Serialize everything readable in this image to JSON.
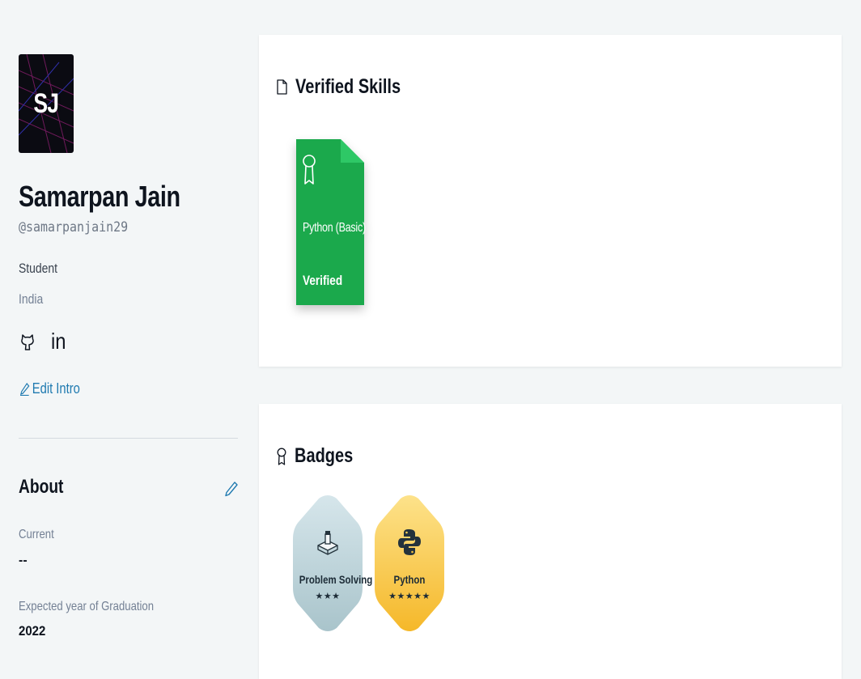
{
  "profile": {
    "initials": "SJ",
    "name": "Samarpan Jain",
    "handle": "@samarpanjain29",
    "role": "Student",
    "country": "India",
    "social": {
      "github_icon": "github-icon",
      "linkedin_text": "in"
    },
    "edit_intro_label": "Edit Intro"
  },
  "about": {
    "title": "About",
    "current_label": "Current",
    "current_value": "--",
    "grad_label": "Expected year of Graduation",
    "grad_value": "2022"
  },
  "skills": {
    "title": "Verified Skills",
    "items": [
      {
        "name": "Python (Basic)",
        "status": "Verified",
        "color": "#1ba94c",
        "fold_color": "#2ec866"
      }
    ]
  },
  "badges": {
    "title": "Badges",
    "items": [
      {
        "name": "Problem Solving",
        "stars": "★★★",
        "star_count": 3,
        "color_top": "#d6e6eb",
        "color_bottom": "#a9c4cb"
      },
      {
        "name": "Python",
        "stars": "★★★★★",
        "star_count": 5,
        "color_top": "#fde28a",
        "color_bottom": "#f5b82a"
      }
    ]
  },
  "colors": {
    "link": "#1f7ab0",
    "background": "#f3f6f7",
    "text": "#0e141e"
  }
}
